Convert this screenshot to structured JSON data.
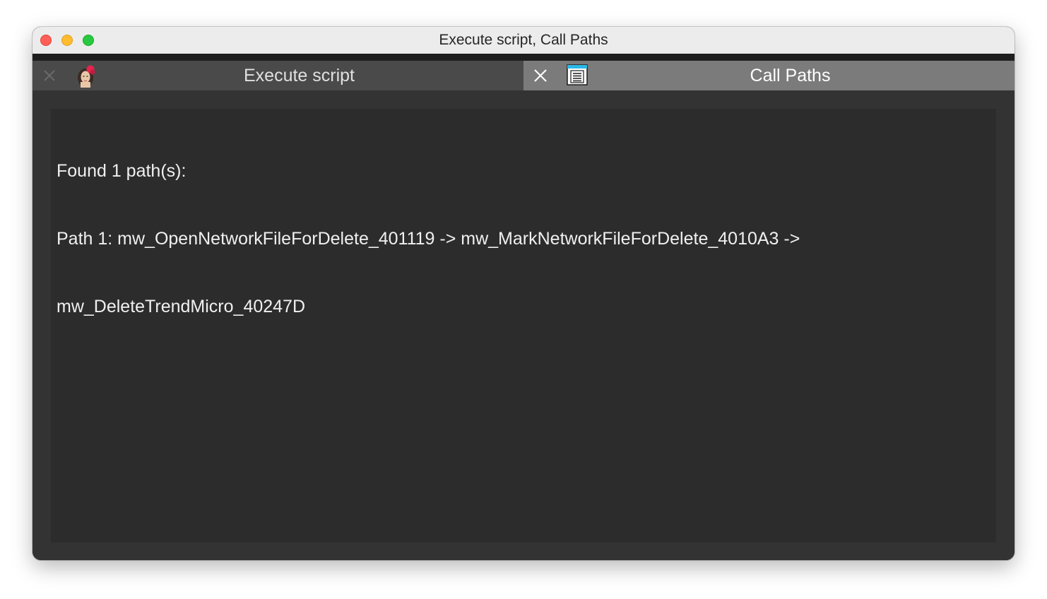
{
  "window": {
    "title": "Execute script, Call Paths"
  },
  "tabs": [
    {
      "label": "Execute script",
      "icon": "portrait-icon",
      "active": false
    },
    {
      "label": "Call Paths",
      "icon": "list-window-icon",
      "active": true
    }
  ],
  "output": {
    "lines": [
      "Found 1 path(s):",
      "Path 1: mw_OpenNetworkFileForDelete_401119 -> mw_MarkNetworkFileForDelete_4010A3 ->",
      "mw_DeleteTrendMicro_40247D"
    ]
  },
  "colors": {
    "traffic_close": "#fe5f57",
    "traffic_minimize": "#febc2e",
    "traffic_zoom": "#28c840",
    "tab_active_bg": "#7b7b7b",
    "tab_inactive_bg": "#4a4a4a",
    "panel_bg": "#2c2c2c"
  }
}
